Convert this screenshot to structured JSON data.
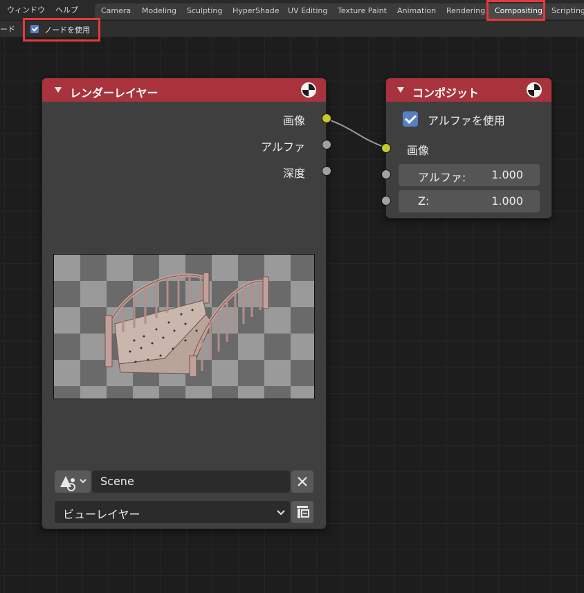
{
  "menu": {
    "window": "ウィンドウ",
    "help": "ヘルプ"
  },
  "tabs": [
    {
      "label": "Camera"
    },
    {
      "label": "Modeling"
    },
    {
      "label": "Sculpting"
    },
    {
      "label": "HyperShade"
    },
    {
      "label": "UV Editing"
    },
    {
      "label": "Texture Paint"
    },
    {
      "label": "Animation"
    },
    {
      "label": "Rendering"
    },
    {
      "label": "Compositing",
      "active": true
    },
    {
      "label": "Scripting"
    }
  ],
  "header": {
    "left_text": "ード",
    "use_nodes_label": "ノードを使用",
    "use_nodes_checked": true
  },
  "render_layer_node": {
    "title": "レンダーレイヤー",
    "header_color": "#a9333d",
    "outputs": [
      {
        "label": "画像",
        "socket_color": "#c7c72e"
      },
      {
        "label": "アルファ",
        "socket_color": "#a1a1a1"
      },
      {
        "label": "深度",
        "socket_color": "#a1a1a1"
      }
    ],
    "scene_name": "Scene",
    "view_layer": "ビューレイヤー"
  },
  "composite_node": {
    "title": "コンポジット",
    "use_alpha_label": "アルファを使用",
    "use_alpha_checked": true,
    "image_input_label": "画像",
    "alpha_label": "アルファ:",
    "alpha_value": "1.000",
    "z_label": "Z:",
    "z_value": "1.000"
  },
  "icons": {
    "node_type": "render-result-icon",
    "scene": "scene-icon",
    "close": "close-icon",
    "view_layer_browse": "view-layer-icon"
  }
}
